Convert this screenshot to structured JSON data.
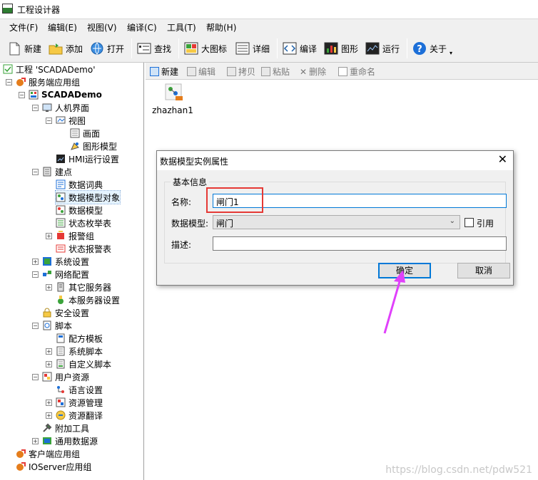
{
  "window": {
    "title": "工程设计器"
  },
  "menu": [
    "文件(F)",
    "编辑(E)",
    "视图(V)",
    "编译(C)",
    "工具(T)",
    "帮助(H)"
  ],
  "toolbar": {
    "new": "新建",
    "add": "添加",
    "open": "打开",
    "find": "查找",
    "large_icon": "大图标",
    "detail": "详细",
    "compile": "编译",
    "graphics": "图形",
    "run": "运行",
    "about": "关于"
  },
  "tree": {
    "project": "工程 'SCADADemo'",
    "server_group": "服务端应用组",
    "scada": "SCADADemo",
    "hmi": "人机界面",
    "view": "视图",
    "screen": "画面",
    "graphic_model": "图形模型",
    "hmi_run": "HMI运行设置",
    "point": "建点",
    "data_dict": "数据词典",
    "data_model_obj": "数据模型对象",
    "data_model": "数据模型",
    "state_enum": "状态枚举表",
    "alarm_group": "报警组",
    "state_alarm": "状态报警表",
    "sys_settings": "系统设置",
    "net_config": "网络配置",
    "other_server": "其它服务器",
    "local_server": "本服务器设置",
    "security": "安全设置",
    "script": "脚本",
    "recipe": "配方模板",
    "sys_script": "系统脚本",
    "custom_script": "自定义脚本",
    "user_res": "用户资源",
    "lang": "语言设置",
    "res_mgr": "资源管理",
    "res_trans": "资源翻译",
    "addon": "附加工具",
    "common_ds": "通用数据源",
    "client_group": "客户端应用组",
    "ioserver_group": "IOServer应用组"
  },
  "right_toolbar": {
    "new": "新建",
    "edit": "编辑",
    "copy": "拷贝",
    "paste": "粘贴",
    "delete": "删除",
    "rename": "重命名"
  },
  "content": {
    "item": "zhazhan1"
  },
  "dialog": {
    "title": "数据模型实例属性",
    "close": "✕",
    "group": "基本信息",
    "name_label": "名称:",
    "name_value": "闸门1",
    "model_label": "数据模型:",
    "model_value": "闸门",
    "ref_label": "引用",
    "desc_label": "描述:",
    "desc_value": "",
    "ok": "确定",
    "cancel": "取消"
  },
  "watermark": "https://blog.csdn.net/pdw521",
  "colors": {
    "highlight_box": "#e53935",
    "arrow": "#e040fb",
    "accent": "#0078d7"
  }
}
